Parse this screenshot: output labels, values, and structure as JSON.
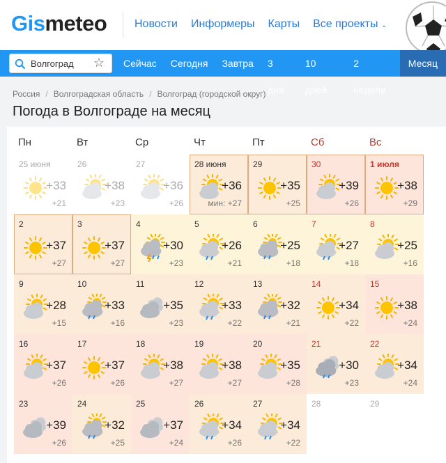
{
  "header": {
    "logo_main": "Gis",
    "logo_rest": "meteo",
    "nav": [
      "Новости",
      "Информеры",
      "Карты",
      "Все проекты"
    ]
  },
  "search": {
    "value": "Волгоград"
  },
  "tabs": [
    "Сейчас",
    "Сегодня",
    "Завтра",
    "3 дня",
    "10 дней",
    "2 недели",
    "Месяц"
  ],
  "active_tab": "Месяц",
  "breadcrumbs": [
    "Россия",
    "Волгоградская область",
    "Волгоград (городской округ)"
  ],
  "page_title": "Погода в Волгограде на месяц",
  "weekdays": [
    "Пн",
    "Вт",
    "Ср",
    "Чт",
    "Пт",
    "Сб",
    "Вс"
  ],
  "colors": {
    "brand": "#2196f3",
    "active_tab": "#2a6cb4",
    "weekend": "#c0392b",
    "hot": "#fde5dc",
    "warm": "#fcebd9",
    "mild": "#fdf4da"
  },
  "weeks": [
    [
      {
        "day": "25 июня",
        "hi": "+33",
        "lo": "+21",
        "icon": "sun",
        "past": true
      },
      {
        "day": "26",
        "hi": "+38",
        "lo": "+23",
        "icon": "sun-cloud",
        "past": true
      },
      {
        "day": "27",
        "hi": "+36",
        "lo": "+26",
        "icon": "sun-cloud",
        "past": true
      },
      {
        "day": "28 июня",
        "hi": "+36",
        "lo": "мин: +27",
        "icon": "sun-cloud",
        "bg": "warm",
        "box": true
      },
      {
        "day": "29",
        "hi": "+35",
        "lo": "+25",
        "icon": "sun",
        "bg": "warm",
        "box": true
      },
      {
        "day": "30",
        "hi": "+39",
        "lo": "+26",
        "icon": "sun-cloud",
        "bg": "hot",
        "box": true,
        "we": true
      },
      {
        "day": "1 июля",
        "hi": "+38",
        "lo": "+29",
        "icon": "sun",
        "bg": "hot",
        "box": true,
        "we": true,
        "hl": true
      }
    ],
    [
      {
        "day": "2",
        "hi": "+37",
        "lo": "+27",
        "icon": "sun",
        "bg": "warm",
        "box": true
      },
      {
        "day": "3",
        "hi": "+37",
        "lo": "+27",
        "icon": "sun",
        "bg": "warm",
        "box": true
      },
      {
        "day": "4",
        "hi": "+30",
        "lo": "+23",
        "icon": "storm",
        "bg": "mild"
      },
      {
        "day": "5",
        "hi": "+26",
        "lo": "+21",
        "icon": "sun-rain",
        "bg": "mild"
      },
      {
        "day": "6",
        "hi": "+25",
        "lo": "+18",
        "icon": "cloud-rain",
        "bg": "mild"
      },
      {
        "day": "7",
        "hi": "+27",
        "lo": "+18",
        "icon": "sun-rain",
        "bg": "mild",
        "we": true
      },
      {
        "day": "8",
        "hi": "+25",
        "lo": "+16",
        "icon": "sun-cloud",
        "bg": "mild",
        "we": true
      }
    ],
    [
      {
        "day": "9",
        "hi": "+28",
        "lo": "+15",
        "icon": "sun-cloud",
        "bg": "warm"
      },
      {
        "day": "10",
        "hi": "+33",
        "lo": "+16",
        "icon": "cloud-rain",
        "bg": "warm"
      },
      {
        "day": "11",
        "hi": "+35",
        "lo": "+23",
        "icon": "cloudy",
        "bg": "warm"
      },
      {
        "day": "12",
        "hi": "+33",
        "lo": "+22",
        "icon": "sun-rain",
        "bg": "warm"
      },
      {
        "day": "13",
        "hi": "+32",
        "lo": "+21",
        "icon": "cloud-rain",
        "bg": "warm"
      },
      {
        "day": "14",
        "hi": "+34",
        "lo": "+22",
        "icon": "sun",
        "bg": "warm",
        "we": true
      },
      {
        "day": "15",
        "hi": "+38",
        "lo": "+24",
        "icon": "sun",
        "bg": "hot",
        "we": true
      }
    ],
    [
      {
        "day": "16",
        "hi": "+37",
        "lo": "+26",
        "icon": "sun-cloud",
        "bg": "hot"
      },
      {
        "day": "17",
        "hi": "+37",
        "lo": "+26",
        "icon": "sun",
        "bg": "hot"
      },
      {
        "day": "18",
        "hi": "+38",
        "lo": "+27",
        "icon": "sun-cloud",
        "bg": "hot"
      },
      {
        "day": "19",
        "hi": "+38",
        "lo": "+27",
        "icon": "sun-cloud",
        "bg": "hot"
      },
      {
        "day": "20",
        "hi": "+35",
        "lo": "+28",
        "icon": "sun-cloud",
        "bg": "hot"
      },
      {
        "day": "21",
        "hi": "+30",
        "lo": "+23",
        "icon": "cloudy-rain",
        "bg": "warm",
        "we": true
      },
      {
        "day": "22",
        "hi": "+34",
        "lo": "+24",
        "icon": "sun-cloud",
        "bg": "warm",
        "we": true
      }
    ],
    [
      {
        "day": "23",
        "hi": "+39",
        "lo": "+26",
        "icon": "cloudy",
        "bg": "hot"
      },
      {
        "day": "24",
        "hi": "+32",
        "lo": "+25",
        "icon": "cloud-rain",
        "bg": "warm"
      },
      {
        "day": "25",
        "hi": "+37",
        "lo": "+24",
        "icon": "cloudy",
        "bg": "hot"
      },
      {
        "day": "26",
        "hi": "+34",
        "lo": "+26",
        "icon": "sun-rain",
        "bg": "warm"
      },
      {
        "day": "27",
        "hi": "+34",
        "lo": "+22",
        "icon": "sun-rain",
        "bg": "warm"
      },
      {
        "day": "28",
        "hi": "",
        "lo": "",
        "icon": "",
        "past": true,
        "empty": true
      },
      {
        "day": "29",
        "hi": "",
        "lo": "",
        "icon": "",
        "past": true,
        "empty": true
      }
    ]
  ]
}
